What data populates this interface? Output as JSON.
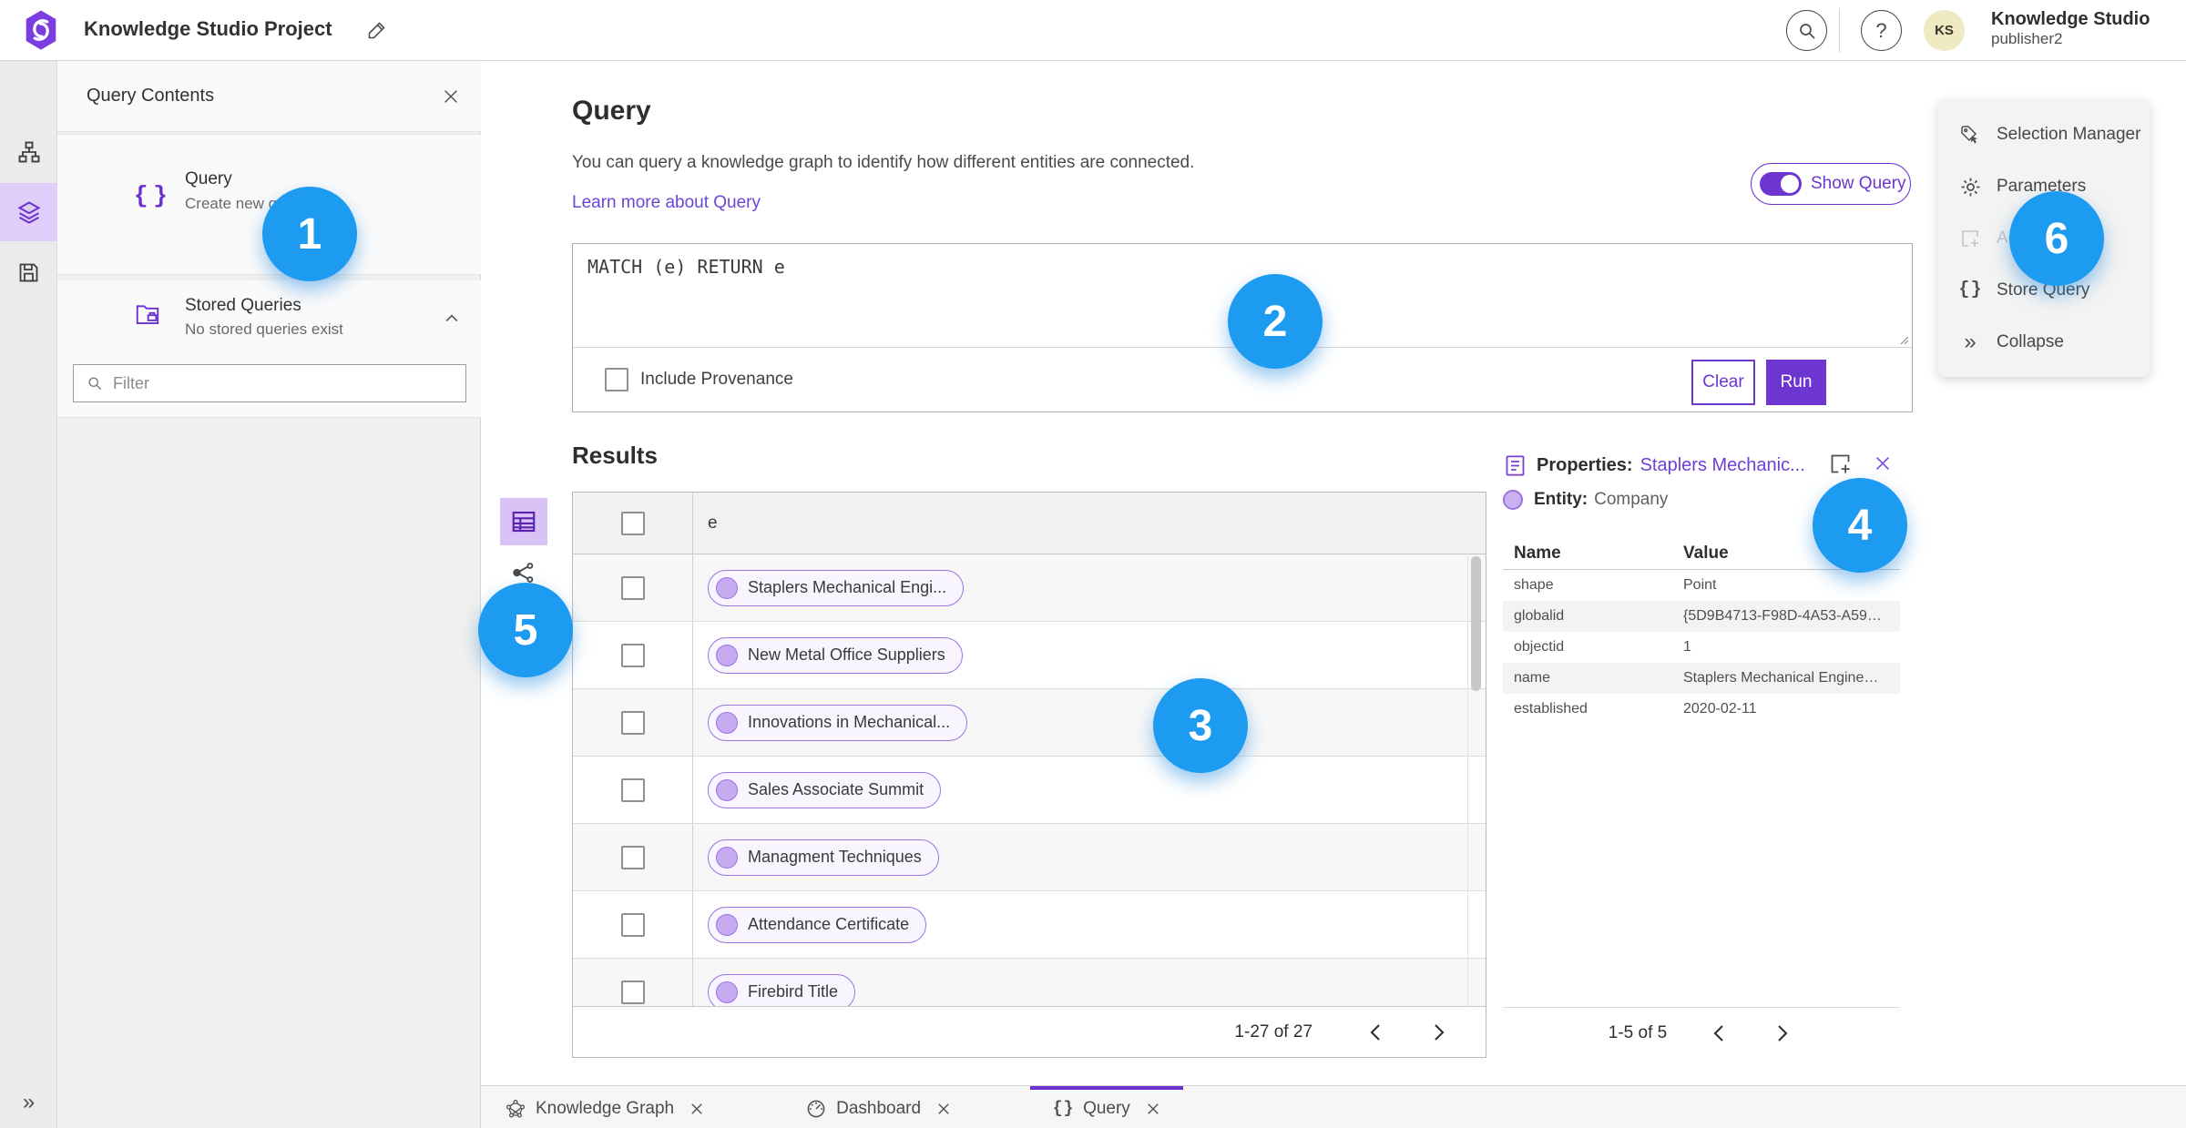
{
  "topbar": {
    "title": "Knowledge Studio Project",
    "user_initials": "KS",
    "user_name": "Knowledge Studio",
    "user_role": "publisher2"
  },
  "contents_panel": {
    "title": "Query Contents",
    "query_item": {
      "label": "Query",
      "description": "Create new queries"
    },
    "stored_item": {
      "label": "Stored Queries",
      "description": "No stored queries exist"
    },
    "filter_placeholder": "Filter"
  },
  "query_section": {
    "heading": "Query",
    "description": "You can query a knowledge graph to identify how different entities are connected.",
    "learn_more": "Learn more about Query",
    "show_query": "Show Query",
    "query_text": "MATCH (e) RETURN e",
    "include_provenance": "Include Provenance",
    "clear": "Clear",
    "run": "Run"
  },
  "results": {
    "heading": "Results",
    "column": "e",
    "rows": [
      {
        "label": "Staplers Mechanical Engi..."
      },
      {
        "label": "New Metal Office Suppliers"
      },
      {
        "label": "Innovations in Mechanical..."
      },
      {
        "label": "Sales Associate Summit"
      },
      {
        "label": "Managment Techniques"
      },
      {
        "label": "Attendance Certificate"
      },
      {
        "label": "Firebird Title"
      }
    ],
    "pagination": "1-27 of 27"
  },
  "properties": {
    "heading": "Properties:",
    "selected": "Staplers Mechanic...",
    "entity_label": "Entity:",
    "entity_type": "Company",
    "name_col": "Name",
    "value_col": "Value",
    "rows": [
      {
        "name": "shape",
        "value": "Point"
      },
      {
        "name": "globalid",
        "value": "{5D9B4713-F98D-4A53-A59F-C11..."
      },
      {
        "name": "objectid",
        "value": "1"
      },
      {
        "name": "name",
        "value": "Staplers Mechanical Engineering"
      },
      {
        "name": "established",
        "value": "2020-02-11"
      }
    ],
    "pagination": "1-5 of 5"
  },
  "tools": {
    "items": [
      {
        "label": "Selection Manager"
      },
      {
        "label": "Parameters"
      },
      {
        "label": "Ad"
      },
      {
        "label": "Store Query"
      },
      {
        "label": "Collapse"
      }
    ]
  },
  "tabs": [
    {
      "label": "Knowledge Graph"
    },
    {
      "label": "Dashboard"
    },
    {
      "label": "Query"
    }
  ],
  "annotations": [
    "1",
    "2",
    "3",
    "4",
    "5",
    "6"
  ],
  "icons": {
    "logo": "purple-hexagon-swirl",
    "edit": "pencil",
    "search": "magnifier-in-circle",
    "help": "question-in-circle",
    "query": "curly-braces",
    "stored_queries": "folder-drawer",
    "table_view": "grid-table",
    "link_chart_view": "share-nodes",
    "properties": "document-lines",
    "add_window": "square-plus",
    "selection_manager": "tag-cursor",
    "parameters": "gear",
    "collapse": "double-chevron-right",
    "knowledge_graph_tab": "network-graph",
    "dashboard_tab": "gauge"
  },
  "colors": {
    "accent_purple": "#6d35d1",
    "annotation_blue": "#1d9bf0",
    "pill_border": "#9b74e0",
    "pill_bg": "#f8f5fe",
    "avatar_bg": "#efeac1",
    "rail_selected_bg": "#e0cdf9"
  }
}
